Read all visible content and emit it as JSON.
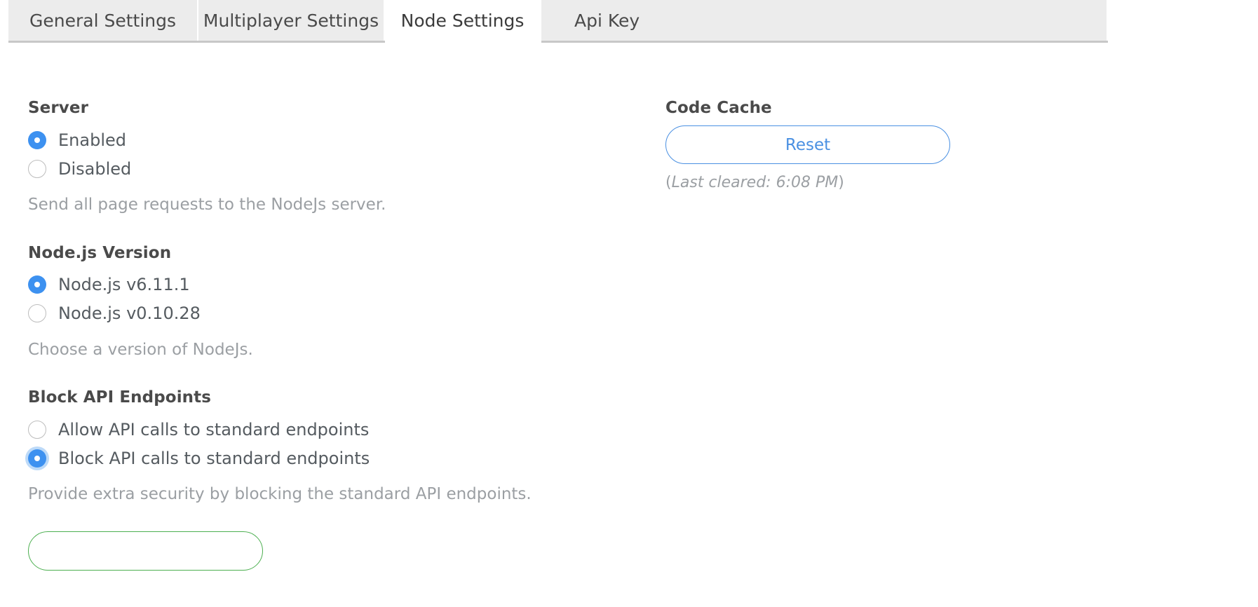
{
  "tabs": [
    {
      "id": "general",
      "label": "General Settings",
      "active": false
    },
    {
      "id": "multiplayer",
      "label": "Multiplayer Settings",
      "active": false
    },
    {
      "id": "node",
      "label": "Node Settings",
      "active": true
    },
    {
      "id": "apikey",
      "label": "Api Key",
      "active": false
    }
  ],
  "server": {
    "title": "Server",
    "options": [
      {
        "label": "Enabled",
        "checked": true,
        "focused": false
      },
      {
        "label": "Disabled",
        "checked": false,
        "focused": false
      }
    ],
    "helper": "Send all page requests to the NodeJs server."
  },
  "node_version": {
    "title": "Node.js Version",
    "options": [
      {
        "label": "Node.js v6.11.1",
        "checked": true,
        "focused": false
      },
      {
        "label": "Node.js v0.10.28",
        "checked": false,
        "focused": false
      }
    ],
    "helper": "Choose a version of NodeJs."
  },
  "block_api": {
    "title": "Block API Endpoints",
    "options": [
      {
        "label": "Allow API calls to standard endpoints",
        "checked": false,
        "focused": false
      },
      {
        "label": "Block API calls to standard endpoints",
        "checked": true,
        "focused": true
      }
    ],
    "helper": "Provide extra security by blocking the standard API endpoints."
  },
  "save_button": {
    "label": ""
  },
  "code_cache": {
    "title": "Code Cache",
    "reset_label": "Reset",
    "last_cleared_prefix": "(",
    "last_cleared_text": "Last cleared: 6:08 PM",
    "last_cleared_suffix": ")"
  },
  "colors": {
    "accent_blue": "#3d91f0",
    "link_blue": "#4a90e2",
    "green": "#4caf50",
    "tab_inactive_bg": "#ececec",
    "tab_active_bg": "#ffffff",
    "heading": "#4a4a4a",
    "body_text": "#555b60",
    "muted_text": "#9b9fa3"
  }
}
